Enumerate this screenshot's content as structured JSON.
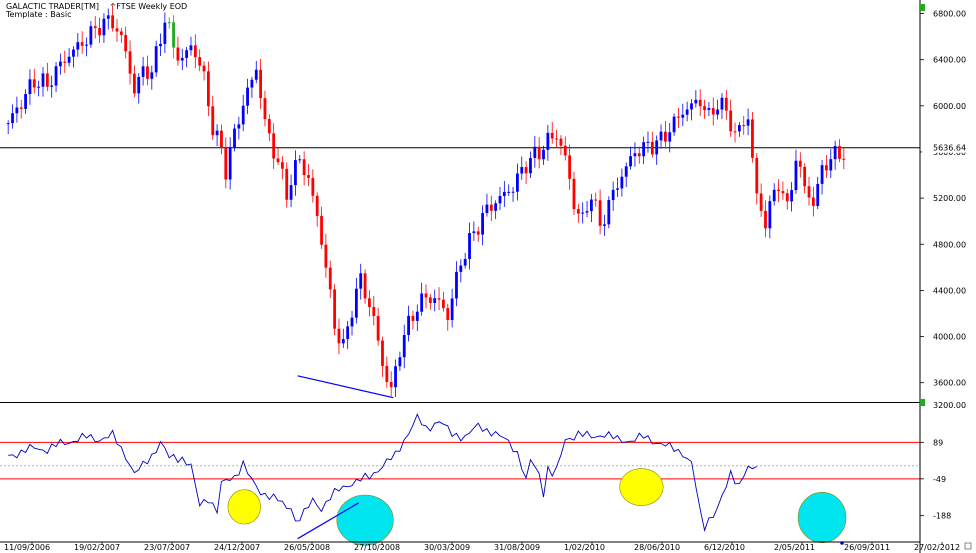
{
  "header": {
    "app_title": "GALACTIC TRADER[TM]",
    "symbol": "^FTSE Weekly EOD",
    "template": "Template : Basic"
  },
  "colors": {
    "up_candle": "#0000ff",
    "down_candle": "#ff0000",
    "green_marker": "#22aa22",
    "oscillator_line": "#0000c0",
    "band_line": "#ff0000",
    "annotation_line": "#0000ff",
    "yellow_highlight": "#ffff00",
    "cyan_highlight": "#00e5ee",
    "grid_dotted": "#999999"
  },
  "chart_data": [
    {
      "type": "candlestick",
      "title": "",
      "ylim": [
        3450,
        6900
      ],
      "y_ticks": [
        "6800.00",
        "6400.00",
        "6000.00",
        "5600.00",
        "5200.00",
        "4800.00",
        "4400.00",
        "4000.00",
        "3600.00"
      ],
      "y_tick_values": [
        6800,
        6400,
        6000,
        5600,
        5200,
        4800,
        4400,
        4000,
        3600
      ],
      "horizontal_line": {
        "value": 5636.64,
        "label": "5636.64"
      },
      "x_ticks": [
        "11/09/2006",
        "19/02/2007",
        "23/07/2007",
        "24/12/2007",
        "26/05/2008",
        "27/10/2008",
        "30/03/2009",
        "31/08/2009",
        "1/02/2010",
        "28/06/2010",
        "6/12/2010",
        "2/05/2011",
        "26/09/2011",
        "27/02/2012"
      ],
      "close_path": [
        [
          0,
          5850
        ],
        [
          3,
          6030
        ],
        [
          6,
          6220
        ],
        [
          9,
          6180
        ],
        [
          12,
          6360
        ],
        [
          15,
          6480
        ],
        [
          18,
          6580
        ],
        [
          21,
          6700
        ],
        [
          24,
          6740
        ],
        [
          27,
          6480
        ],
        [
          29,
          6120
        ],
        [
          31,
          6320
        ],
        [
          33,
          6280
        ],
        [
          36,
          6760
        ],
        [
          38,
          6520
        ],
        [
          40,
          6380
        ],
        [
          42,
          6540
        ],
        [
          45,
          6250
        ],
        [
          47,
          5800
        ],
        [
          49,
          5620
        ],
        [
          50,
          5450
        ],
        [
          53,
          5900
        ],
        [
          55,
          6120
        ],
        [
          57,
          6330
        ],
        [
          59,
          5850
        ],
        [
          62,
          5500
        ],
        [
          64,
          5250
        ],
        [
          67,
          5550
        ],
        [
          69,
          5350
        ],
        [
          71,
          5050
        ],
        [
          73,
          4600
        ],
        [
          75,
          4100
        ],
        [
          77,
          3900
        ],
        [
          79,
          4250
        ],
        [
          81,
          4500
        ],
        [
          84,
          4150
        ],
        [
          86,
          3760
        ],
        [
          88,
          3520
        ],
        [
          90,
          3900
        ],
        [
          93,
          4200
        ],
        [
          96,
          4350
        ],
        [
          99,
          4300
        ],
        [
          101,
          4180
        ],
        [
          104,
          4650
        ],
        [
          107,
          4900
        ],
        [
          110,
          5100
        ],
        [
          113,
          5200
        ],
        [
          116,
          5300
        ],
        [
          119,
          5500
        ],
        [
          122,
          5600
        ],
        [
          124,
          5700
        ],
        [
          126,
          5750
        ],
        [
          128,
          5550
        ],
        [
          130,
          5150
        ],
        [
          132,
          5000
        ],
        [
          134,
          5250
        ],
        [
          136,
          4950
        ],
        [
          138,
          5150
        ],
        [
          141,
          5400
        ],
        [
          144,
          5600
        ],
        [
          147,
          5650
        ],
        [
          150,
          5700
        ],
        [
          153,
          5850
        ],
        [
          155,
          5950
        ],
        [
          157,
          6000
        ],
        [
          159,
          6050
        ],
        [
          161,
          5900
        ],
        [
          163,
          6030
        ],
        [
          165,
          5950
        ],
        [
          167,
          5750
        ],
        [
          170,
          5900
        ],
        [
          172,
          5200
        ],
        [
          174,
          5000
        ],
        [
          177,
          5350
        ],
        [
          179,
          5100
        ],
        [
          181,
          5550
        ],
        [
          183,
          5300
        ],
        [
          185,
          5150
        ],
        [
          187,
          5450
        ],
        [
          189,
          5550
        ],
        [
          192,
          5600
        ]
      ],
      "annotation": {
        "type": "trendline",
        "from": [
          66.5,
          3660
        ],
        "to": [
          88.5,
          3470
        ]
      }
    },
    {
      "type": "line",
      "title": "",
      "ylim": [
        -280,
        230
      ],
      "y_ticks": [
        "3200.00",
        "89",
        "-49",
        "-188"
      ],
      "y_tick_values": [
        230,
        89,
        -49,
        -188
      ],
      "bands": [
        89,
        -49
      ],
      "midline": 0,
      "x_ticks": [
        "11/09/2006",
        "19/02/2007",
        "23/07/2007",
        "24/12/2007",
        "26/05/2008",
        "27/10/2008",
        "30/03/2009",
        "31/08/2009",
        "1/02/2010",
        "28/06/2010",
        "6/12/2010",
        "2/05/2011",
        "26/09/2011",
        "27/02/2012"
      ],
      "series": [
        {
          "values": [
            [
              0,
              40
            ],
            [
              3,
              50
            ],
            [
              6,
              70
            ],
            [
              9,
              60
            ],
            [
              12,
              85
            ],
            [
              15,
              95
            ],
            [
              18,
              110
            ],
            [
              21,
              100
            ],
            [
              24,
              115
            ],
            [
              27,
              40
            ],
            [
              29,
              -30
            ],
            [
              31,
              0
            ],
            [
              33,
              40
            ],
            [
              35,
              90
            ],
            [
              37,
              30
            ],
            [
              40,
              30
            ],
            [
              42,
              0
            ],
            [
              43,
              -80
            ],
            [
              44,
              -150
            ],
            [
              46,
              -120
            ],
            [
              48,
              -170
            ],
            [
              49,
              -70
            ],
            [
              52,
              -40
            ],
            [
              54,
              10
            ],
            [
              56,
              -60
            ],
            [
              58,
              -100
            ],
            [
              60,
              -110
            ],
            [
              62,
              -130
            ],
            [
              64,
              -160
            ],
            [
              65,
              -150
            ],
            [
              66,
              -210
            ],
            [
              68,
              -180
            ],
            [
              70,
              -130
            ],
            [
              72,
              -160
            ],
            [
              74,
              -120
            ],
            [
              76,
              -90
            ],
            [
              78,
              -70
            ],
            [
              80,
              -60
            ],
            [
              83,
              -40
            ],
            [
              86,
              0
            ],
            [
              89,
              40
            ],
            [
              91,
              100
            ],
            [
              94,
              180
            ],
            [
              96,
              140
            ],
            [
              99,
              170
            ],
            [
              102,
              120
            ],
            [
              105,
              110
            ],
            [
              108,
              150
            ],
            [
              111,
              130
            ],
            [
              113,
              110
            ],
            [
              115,
              90
            ],
            [
              117,
              50
            ],
            [
              118,
              0
            ],
            [
              119,
              -60
            ],
            [
              120,
              20
            ],
            [
              122,
              -30
            ],
            [
              123,
              -100
            ],
            [
              124,
              -10
            ],
            [
              125,
              -30
            ],
            [
              126,
              -20
            ],
            [
              128,
              100
            ],
            [
              131,
              120
            ],
            [
              134,
              110
            ],
            [
              137,
              120
            ],
            [
              140,
              100
            ],
            [
              143,
              95
            ],
            [
              146,
              110
            ],
            [
              149,
              90
            ],
            [
              152,
              70
            ],
            [
              155,
              50
            ],
            [
              157,
              10
            ],
            [
              158,
              -80
            ],
            [
              159,
              -180
            ],
            [
              160,
              -230
            ],
            [
              161,
              -200
            ],
            [
              163,
              -160
            ],
            [
              164,
              -120
            ],
            [
              165,
              -80
            ],
            [
              166,
              -30
            ],
            [
              167,
              -50
            ],
            [
              168,
              -70
            ],
            [
              169,
              -30
            ],
            [
              170,
              -10
            ],
            [
              171,
              -20
            ],
            [
              172,
              0
            ]
          ]
        }
      ],
      "annotation": {
        "type": "trendline",
        "from": [
          66.5,
          -275
        ],
        "to": [
          80.5,
          -140
        ]
      }
    }
  ]
}
